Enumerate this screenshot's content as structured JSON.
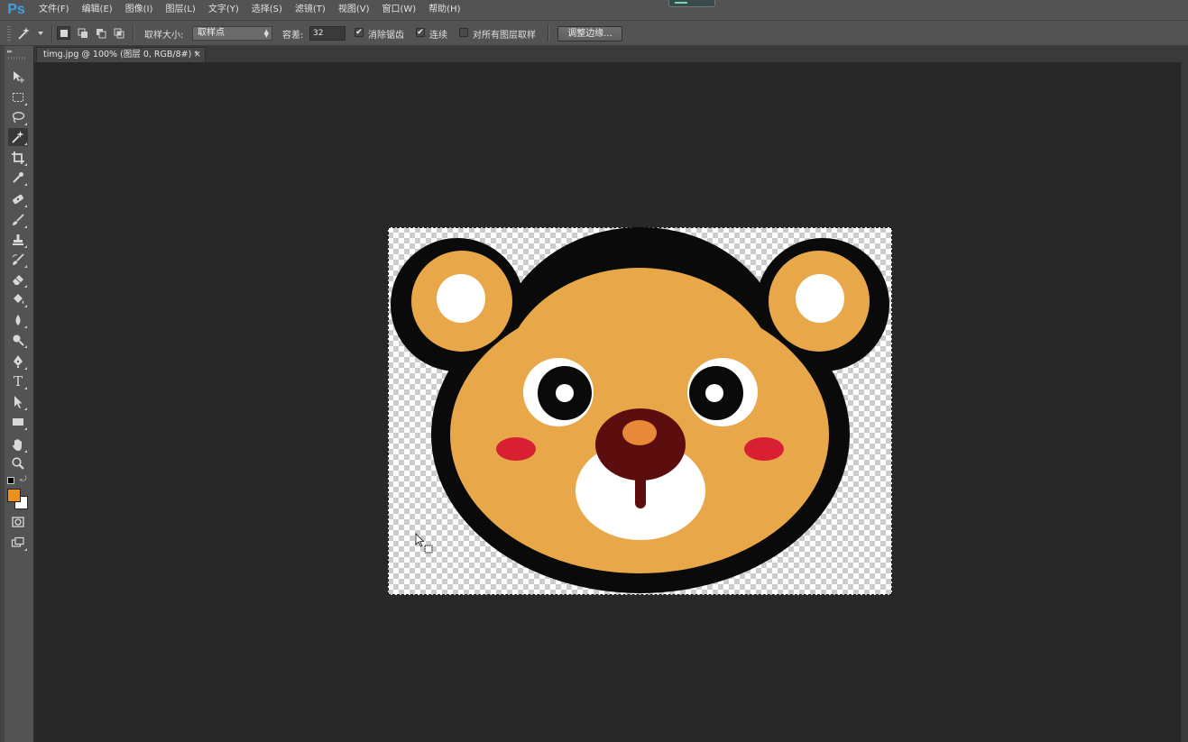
{
  "app": {
    "logo": "Ps"
  },
  "menu": [
    "文件(F)",
    "编辑(E)",
    "图像(I)",
    "图层(L)",
    "文字(Y)",
    "选择(S)",
    "滤镜(T)",
    "视图(V)",
    "窗口(W)",
    "帮助(H)"
  ],
  "options": {
    "sample_size_label": "取样大小:",
    "sample_size_value": "取样点",
    "tolerance_label": "容差:",
    "tolerance_value": "32",
    "anti_alias_label": "消除锯齿",
    "anti_alias_checked": true,
    "contiguous_label": "连续",
    "contiguous_checked": true,
    "sample_all_layers_label": "对所有图层取样",
    "sample_all_layers_checked": false,
    "refine_edge_label": "调整边缘..."
  },
  "document_tab": {
    "title": "timg.jpg @ 100% (图层 0, RGB/8#) *",
    "close": "×"
  },
  "colors": {
    "foreground": "#f0901a",
    "background": "#ffffff"
  },
  "tools": [
    "move-tool-icon",
    "marquee-tool-icon",
    "lasso-tool-icon",
    "magic-wand-tool-icon",
    "crop-tool-icon",
    "eyedropper-tool-icon",
    "healing-brush-tool-icon",
    "brush-tool-icon",
    "clone-stamp-tool-icon",
    "history-brush-tool-icon",
    "eraser-tool-icon",
    "paint-bucket-tool-icon",
    "blur-tool-icon",
    "dodge-tool-icon",
    "pen-tool-icon",
    "type-tool-icon",
    "path-selection-tool-icon",
    "rectangle-tool-icon",
    "hand-tool-icon",
    "zoom-tool-icon"
  ],
  "type_tool_glyph": "T"
}
